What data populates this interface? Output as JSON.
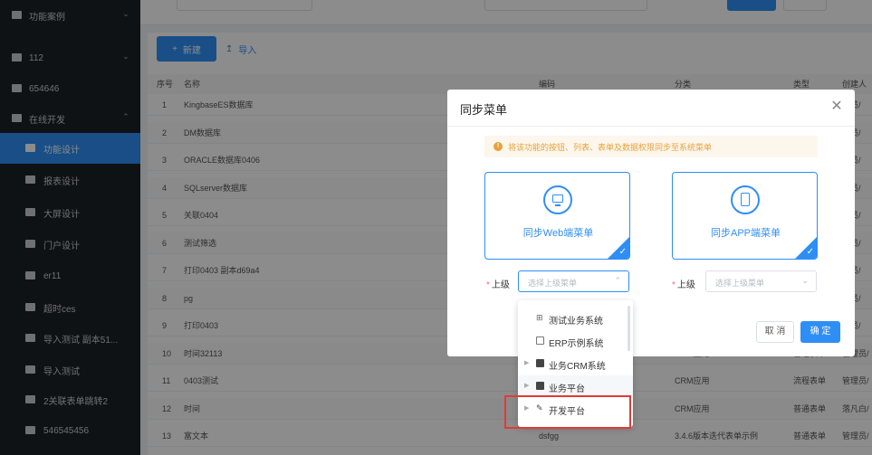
{
  "sidebar": {
    "items": [
      {
        "label": "功能案例",
        "icon": "folder-icon",
        "chevron": "chevron-down-icon"
      },
      {
        "label": "112",
        "icon": "monitor-icon",
        "chevron": "chevron-down-icon"
      },
      {
        "label": "654646",
        "icon": "card-icon"
      },
      {
        "label": "在线开发",
        "icon": "dev-icon",
        "chevron": "chevron-up-icon"
      },
      {
        "label": "功能设计",
        "icon": "table-icon",
        "active": true
      },
      {
        "label": "报表设计",
        "icon": "report-icon"
      },
      {
        "label": "大屏设计",
        "icon": "screen-icon"
      },
      {
        "label": "门户设计",
        "icon": "portal-icon"
      },
      {
        "label": "er11",
        "icon": "doc-icon"
      },
      {
        "label": "超时ces",
        "icon": "doc-icon"
      },
      {
        "label": "导入测试 副本51...",
        "icon": "doc-icon"
      },
      {
        "label": "导入测试",
        "icon": "doc-icon"
      },
      {
        "label": "2关联表单跳转2",
        "icon": "doc-icon"
      },
      {
        "label": "546545456",
        "icon": "doc-icon"
      }
    ]
  },
  "toolbar": {
    "new_label": "新建",
    "import_label": "导入"
  },
  "table": {
    "headers": [
      "序号",
      "名称",
      "编码",
      "分类",
      "类型",
      "创建人"
    ],
    "rows": [
      {
        "no": "1",
        "name": "KingbaseES数据库",
        "code": "",
        "category": "",
        "type": "",
        "creator": "理员/"
      },
      {
        "no": "2",
        "name": "DM数据库",
        "code": "",
        "category": "",
        "type": "",
        "creator": "理员/"
      },
      {
        "no": "3",
        "name": "ORACLE数据库0406",
        "code": "",
        "category": "",
        "type": "",
        "creator": "理员/"
      },
      {
        "no": "4",
        "name": "SQLserver数据库",
        "code": "",
        "category": "",
        "type": "",
        "creator": "理员/"
      },
      {
        "no": "5",
        "name": "关联0404",
        "code": "",
        "category": "",
        "type": "",
        "creator": "理员/"
      },
      {
        "no": "6",
        "name": "测试筛选",
        "code": "",
        "category": "",
        "type": "",
        "creator": "理员/"
      },
      {
        "no": "7",
        "name": "打印0403 副本d69a4",
        "code": "",
        "category": "",
        "type": "",
        "creator": "理员/"
      },
      {
        "no": "8",
        "name": "pg",
        "code": "",
        "category": "",
        "type": "",
        "creator": "理员/"
      },
      {
        "no": "9",
        "name": "打印0403",
        "code": "",
        "category": "",
        "type": "",
        "creator": "理员/"
      },
      {
        "no": "10",
        "name": "时间32113",
        "code": "",
        "category": "CRM应用",
        "type": "普通表单",
        "creator": "管理员/"
      },
      {
        "no": "11",
        "name": "0403测试",
        "code": "",
        "category": "CRM应用",
        "type": "流程表单",
        "creator": "管理员/"
      },
      {
        "no": "12",
        "name": "时间",
        "code": "",
        "category": "CRM应用",
        "type": "普通表单",
        "creator": "落凡白/"
      },
      {
        "no": "13",
        "name": "富文本",
        "code": "dsfgg",
        "category": "3.4.6版本迭代表单示例",
        "type": "普通表单",
        "creator": "管理员/"
      }
    ]
  },
  "modal": {
    "title": "同步菜单",
    "notice": "将该功能的按钮、列表、表单及数据权限同步至系统菜单",
    "card_web": "同步Web端菜单",
    "card_app": "同步APP端菜单",
    "field_label": "上级",
    "field_placeholder": "选择上级菜单",
    "cancel_label": "取 消",
    "ok_label": "确 定"
  },
  "dropdown": {
    "items": [
      {
        "label": "测试业务系统",
        "icon": "grid-icon",
        "expandable": false
      },
      {
        "label": "ERP示例系统",
        "icon": "list-icon",
        "expandable": false
      },
      {
        "label": "业务CRM系统",
        "icon": "doc-icon",
        "expandable": true
      },
      {
        "label": "业务平台",
        "icon": "platform-icon",
        "expandable": true
      },
      {
        "label": "开发平台",
        "icon": "dev-icon",
        "expandable": true
      }
    ]
  },
  "colors": {
    "accent": "#2e8ef6",
    "sidebar_bg": "#1d2126",
    "warning": "#e6a23c",
    "highlight_box": "#e53935"
  }
}
